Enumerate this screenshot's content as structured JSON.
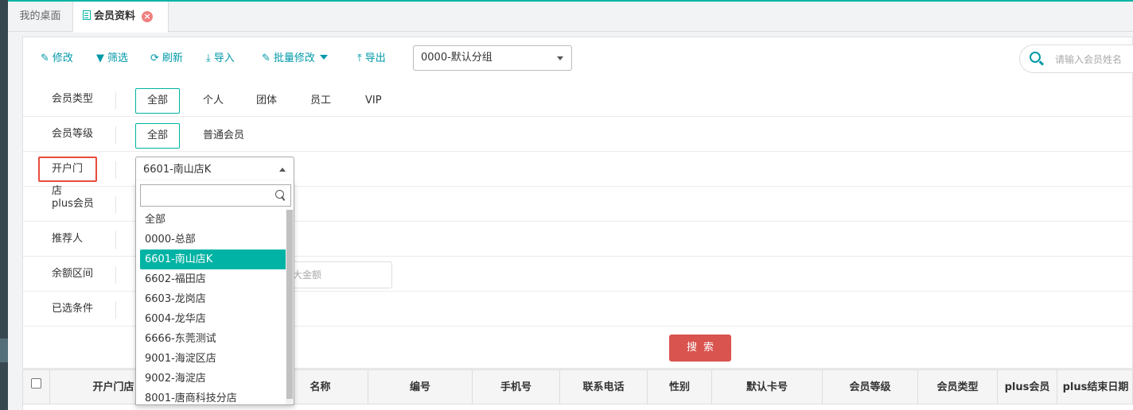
{
  "tabs": {
    "desktop": "我的桌面",
    "member": "会员资料",
    "close_glyph": "×"
  },
  "toolbar": {
    "edit": "修改",
    "filter": "筛选",
    "refresh": "刷新",
    "import": "导入",
    "batch_edit": "批量修改",
    "export": "导出",
    "group_select_value": "0000-默认分组",
    "search_placeholder": "请输入会员姓名"
  },
  "filters": {
    "member_type": {
      "label": "会员类型",
      "options": [
        "全部",
        "个人",
        "团体",
        "员工",
        "VIP"
      ],
      "selected": "全部"
    },
    "member_level": {
      "label": "会员等级",
      "options": [
        "全部",
        "普通会员"
      ],
      "selected": "全部"
    },
    "store": {
      "label": "开户门店",
      "value": "6601-南山店K"
    },
    "plus_member": {
      "label": "plus会员"
    },
    "referrer": {
      "label": "推荐人"
    },
    "balance_range": {
      "label": "余额区间",
      "max_placeholder": "大金额"
    },
    "selected_conditions": {
      "label": "已选条件"
    }
  },
  "store_dropdown": {
    "items": [
      "全部",
      "0000-总部",
      "6601-南山店K",
      "6602-福田店",
      "6603-龙岗店",
      "6004-龙华店",
      "6666-东莞测试",
      "9001-海淀区店",
      "9002-海淀店",
      "8001-唐商科技分店"
    ],
    "selected_index": 2
  },
  "search_button": "搜索",
  "table": {
    "columns": [
      "开户门店",
      "名称",
      "编号",
      "手机号",
      "联系电话",
      "性别",
      "默认卡号",
      "会员等级",
      "会员类型",
      "plus会员",
      "plus结束日期"
    ]
  },
  "colors": {
    "accent": "#00b3a4",
    "link": "#0099a8",
    "danger": "#d9534f",
    "highlight_box": "#e74c3c"
  }
}
